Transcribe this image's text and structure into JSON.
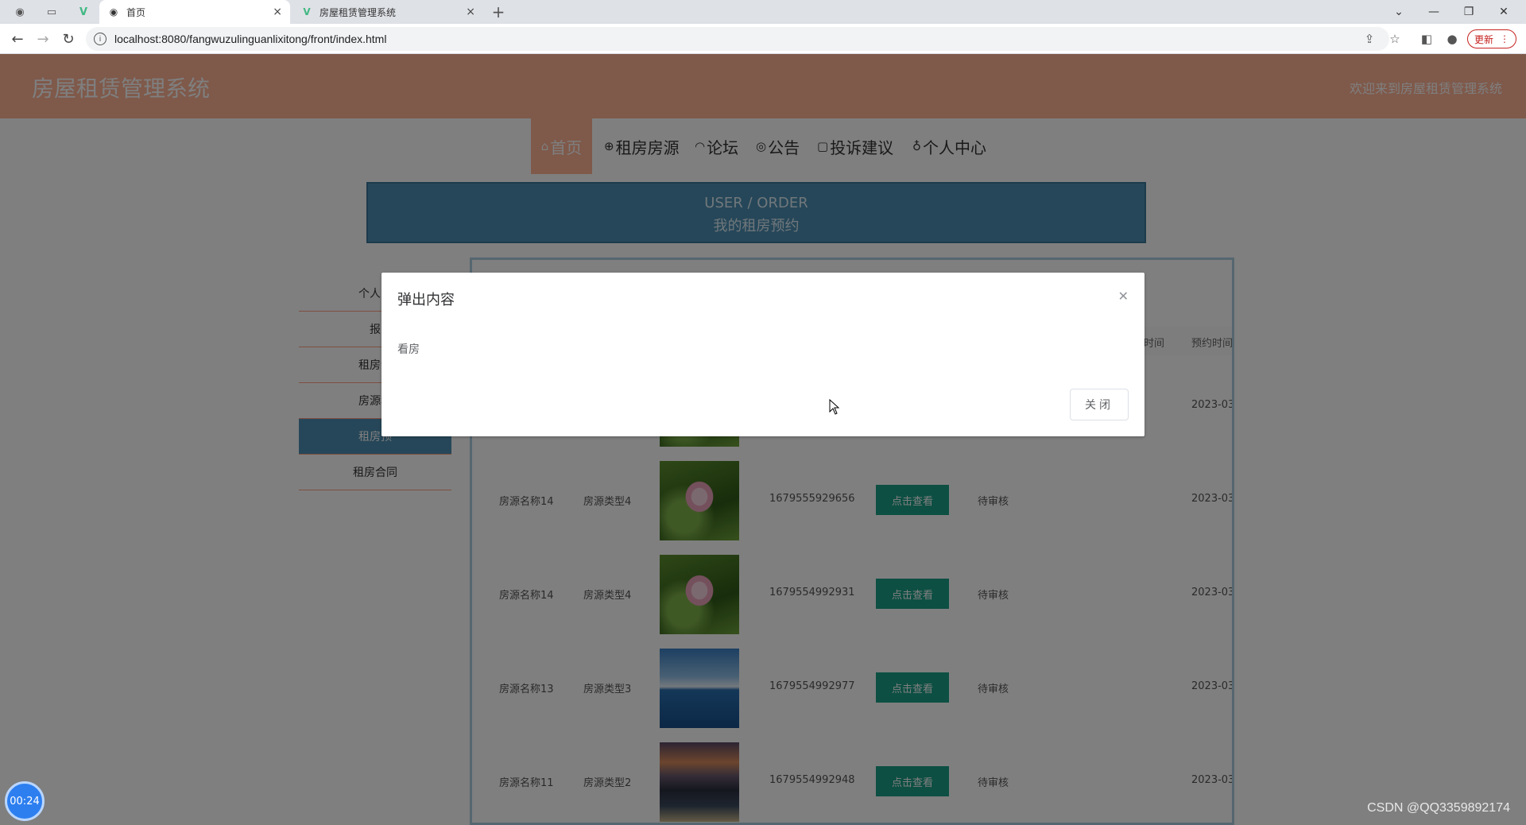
{
  "browser": {
    "tabs": [
      {
        "label": "首页",
        "active": true
      },
      {
        "label": "房屋租赁管理系统",
        "active": false
      }
    ],
    "new_tab": "+",
    "url": "localhost:8080/fangwuzulinguanlixitong/front/index.html",
    "update_label": "更新"
  },
  "site": {
    "title": "房屋租赁管理系统",
    "welcome": "欢迎来到房屋租赁管理系统",
    "nav": [
      {
        "label": "首页",
        "icon": "home-icon",
        "active": true
      },
      {
        "label": "租房房源",
        "icon": "globe-icon",
        "active": false
      },
      {
        "label": "论坛",
        "icon": "chat-icon",
        "active": false
      },
      {
        "label": "公告",
        "icon": "palette-icon",
        "active": false
      },
      {
        "label": "投诉建议",
        "icon": "document-icon",
        "active": false
      },
      {
        "label": "个人中心",
        "icon": "user-icon",
        "active": false
      }
    ]
  },
  "banner": {
    "en": "USER / ORDER",
    "cn": "我的租房预约"
  },
  "side_menu": [
    {
      "label": "个人中",
      "active": false
    },
    {
      "label": "报",
      "active": false
    },
    {
      "label": "租房评",
      "active": false
    },
    {
      "label": "房源租",
      "active": false
    },
    {
      "label": "租房预",
      "active": true
    },
    {
      "label": "租房合同",
      "active": false
    }
  ],
  "table": {
    "headers": [
      "时间",
      "预约时间"
    ],
    "rows": [
      {
        "name": "",
        "type": "",
        "order_no": "",
        "action": "",
        "status": "",
        "date": "2023-03",
        "image": "lotus"
      },
      {
        "name": "房源名称14",
        "type": "房源类型4",
        "order_no": "1679555929656",
        "action": "点击查看",
        "status": "待审核",
        "date": "2023-03",
        "image": "lotus"
      },
      {
        "name": "房源名称14",
        "type": "房源类型4",
        "order_no": "1679554992931",
        "action": "点击查看",
        "status": "待审核",
        "date": "2023-03",
        "image": "lotus"
      },
      {
        "name": "房源名称13",
        "type": "房源类型3",
        "order_no": "1679554992977",
        "action": "点击查看",
        "status": "待审核",
        "date": "2023-03",
        "image": "sea"
      },
      {
        "name": "房源名称11",
        "type": "房源类型2",
        "order_no": "1679554992948",
        "action": "点击查看",
        "status": "待审核",
        "date": "2023-03",
        "image": "city"
      }
    ]
  },
  "dialog": {
    "title": "弹出内容",
    "body": "看房",
    "close_label": "关闭"
  },
  "timer": "00:24",
  "watermark": "CSDN @QQ3359892174",
  "colors": {
    "accent": "#ffb294",
    "primary": "#4c8fb3",
    "button": "#1b9e86"
  }
}
